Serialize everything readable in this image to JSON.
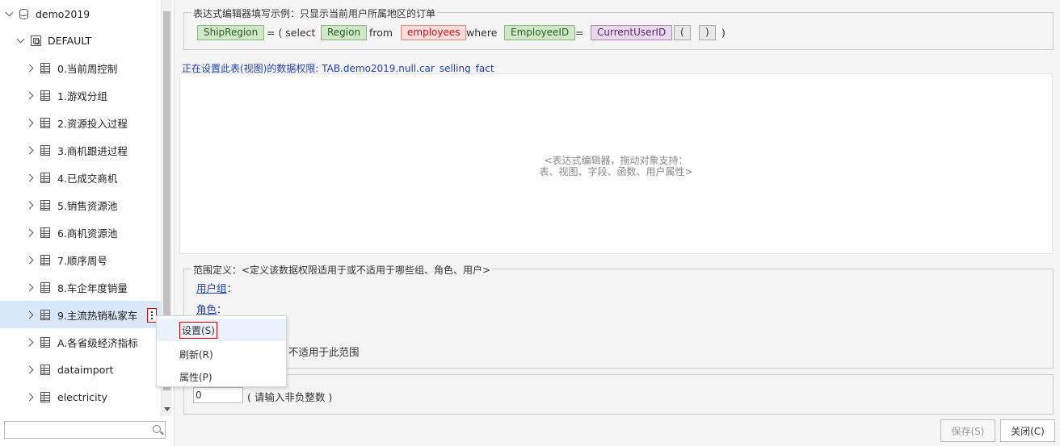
{
  "tree": {
    "root": "demo2019",
    "schema": "DEFAULT",
    "items": [
      "0.当前周控制",
      "1.游戏分组",
      "2.资源投入过程",
      "3.商机跟进过程",
      "4.已成交商机",
      "5.销售资源池",
      "6.商机资源池",
      "7.顺序周号",
      "8.车企年度销量",
      "9.主流热销私家车",
      "A.各省级经济指标",
      "dataimport",
      "electricity"
    ],
    "selected_index": 9
  },
  "example": {
    "legend": "表达式编辑器填写示例：只显示当前用户所属地区的订单",
    "ship_region": "ShipRegion",
    "eq1": "= ( select",
    "region": "Region",
    "from": "from",
    "employees": "employees",
    "where": "where",
    "employee_id": "EmployeeID",
    "eq2": "=",
    "current_user_id": "CurrentUserID",
    "lparen": "(",
    "rparen": ")",
    "close_paren": ")"
  },
  "permission_title": "正在设置此表(视图)的数据权限: TAB.demo2019.null.car_selling_fact",
  "editor_hint": {
    "line1": "<表达式编辑器，拖动对象支持：",
    "line2": "表、视图、字段、函数、用户属性>"
  },
  "scope": {
    "legend": "范围定义：<定义该数据权限适用于或不适用于哪些组、角色、用户>",
    "user_group": "用户组",
    "role": "角色",
    "colon": "：",
    "not_apply": "不适用于此范围"
  },
  "limit": {
    "value": "0",
    "hint": "( 请输入非负整数 )"
  },
  "buttons": {
    "save": "保存(S)",
    "close": "关闭(C)"
  },
  "context_menu": {
    "items": [
      "设置(S)",
      "刷新(R)",
      "属性(P)"
    ]
  },
  "colors": {
    "link": "#1f3fbf",
    "selected_row": "#d9e8f8",
    "highlight_border": "#dd0000"
  }
}
